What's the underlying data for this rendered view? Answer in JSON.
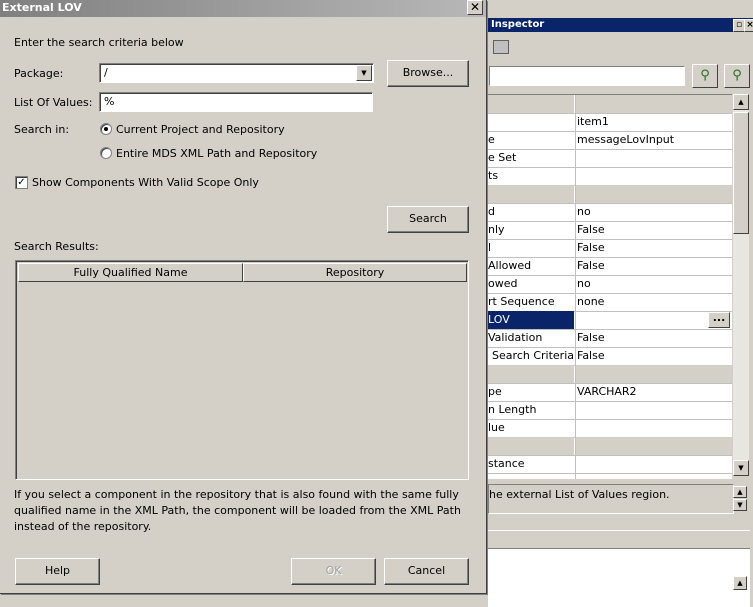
{
  "dialog": {
    "title": "External LOV",
    "close_glyph": "✕",
    "instructions": "Enter the search criteria below",
    "package_label": "Package:",
    "package_value": "/",
    "browse_label": "Browse...",
    "lov_label": "List Of Values:",
    "lov_value": "%",
    "search_in_label": "Search in:",
    "radio_current": "Current Project and Repository",
    "radio_entire": "Entire MDS XML Path and Repository",
    "radio_selected": "current",
    "show_valid_scope": "Show Components With Valid Scope Only",
    "show_valid_scope_checked": true,
    "search_button": "Search",
    "results_label": "Search Results:",
    "columns": [
      "Fully Qualified Name",
      "Repository"
    ],
    "note": "If you select a component in the repository that is also found with the same fully qualified name in the XML Path, the component will be loaded from the XML Path instead of the repository.",
    "help_button": "Help",
    "ok_button": "OK",
    "cancel_button": "Cancel"
  },
  "inspector": {
    "title": "Inspector",
    "rows": [
      {
        "key": "",
        "value": "",
        "type": "section"
      },
      {
        "key": "",
        "value": "item1"
      },
      {
        "key": "e",
        "value": "messageLovInput"
      },
      {
        "key": "e Set",
        "value": ""
      },
      {
        "key": "ts",
        "value": ""
      },
      {
        "key": "",
        "value": "",
        "type": "section"
      },
      {
        "key": "d",
        "value": "no"
      },
      {
        "key": "nly",
        "value": "False"
      },
      {
        "key": "l",
        "value": "False"
      },
      {
        "key": "Allowed",
        "value": "False"
      },
      {
        "key": "owed",
        "value": "no"
      },
      {
        "key": "rt Sequence",
        "value": "none"
      },
      {
        "key": "LOV",
        "value": "",
        "type": "selected"
      },
      {
        "key": "Validation",
        "value": "False"
      },
      {
        "key": "e Search Criteria",
        "value": "False"
      },
      {
        "key": "",
        "value": "",
        "type": "section"
      },
      {
        "key": "pe",
        "value": "VARCHAR2"
      },
      {
        "key": "n Length",
        "value": ""
      },
      {
        "key": "lue",
        "value": ""
      },
      {
        "key": "",
        "value": "",
        "type": "section"
      },
      {
        "key": "stance",
        "value": ""
      },
      {
        "key": "",
        "value": ""
      }
    ],
    "description": "he external List of Values region.",
    "ellipsis": "..."
  }
}
